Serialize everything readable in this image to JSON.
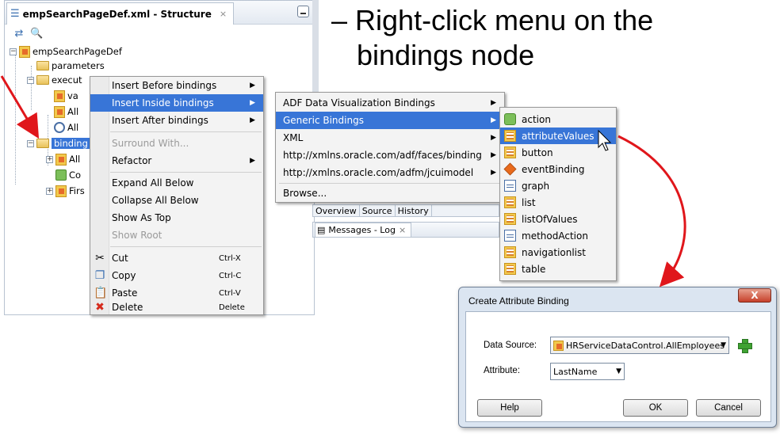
{
  "slide": {
    "bullet_line1": "– Right-click menu on the",
    "bullet_line2": "bindings node"
  },
  "panel": {
    "title": "empSearchPageDef.xml - Structure",
    "close_glyph": "×"
  },
  "tree": {
    "root": "empSearchPageDef",
    "parameters": "parameters",
    "executables": "execut",
    "exec_child1": "va",
    "exec_child2": "All",
    "exec_child3": "All",
    "bindings": "binding",
    "binding_child1": "All",
    "binding_child2": "Co",
    "binding_child3": "Firs"
  },
  "context_menu": {
    "insert_before": "Insert Before bindings",
    "insert_inside": "Insert Inside bindings",
    "insert_after": "Insert After bindings",
    "surround_with": "Surround With...",
    "refactor": "Refactor",
    "expand_all": "Expand All Below",
    "collapse_all": "Collapse All Below",
    "show_as_top": "Show As Top",
    "show_root": "Show Root",
    "cut": "Cut",
    "cut_sc": "Ctrl-X",
    "copy": "Copy",
    "copy_sc": "Ctrl-C",
    "paste": "Paste",
    "paste_sc": "Ctrl-V",
    "delete": "Delete",
    "delete_sc": "Delete"
  },
  "submenu1": {
    "adf_dv": "ADF Data Visualization Bindings",
    "generic": "Generic Bindings",
    "xml": "XML",
    "faces": "http://xmlns.oracle.com/adf/faces/binding",
    "jcui": "http://xmlns.oracle.com/adfm/jcuimodel",
    "browse": "Browse..."
  },
  "submenu2": {
    "action": "action",
    "attributeValues": "attributeValues",
    "button": "button",
    "eventBinding": "eventBinding",
    "graph": "graph",
    "list": "list",
    "listOfValues": "listOfValues",
    "methodAction": "methodAction",
    "navigationlist": "navigationlist",
    "table": "table"
  },
  "editor": {
    "tab_overview": "Overview",
    "tab_source": "Source",
    "tab_history": "History",
    "messages_tab": "Messages - Log",
    "messages_close": "×"
  },
  "dialog": {
    "title": "Create Attribute Binding",
    "close_glyph": "X",
    "data_source_label": "Data Source:",
    "data_source_value": "HRServiceDataControl.AllEmployees",
    "attribute_label": "Attribute:",
    "attribute_value": "LastName",
    "help": "Help",
    "ok": "OK",
    "cancel": "Cancel"
  },
  "colors": {
    "selection": "#3875d7",
    "annotation_arrow": "#e0161b",
    "dialog_frame": "#dbe5f1"
  }
}
